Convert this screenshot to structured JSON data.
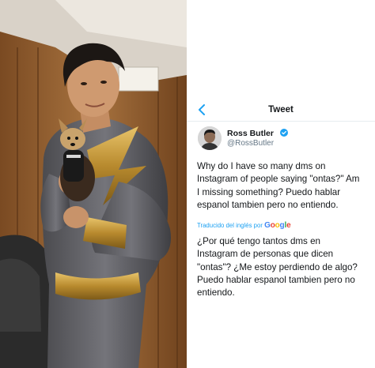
{
  "photo": {
    "description_icon": "person-photo"
  },
  "nav": {
    "back_icon": "chevron-left-icon",
    "title": "Tweet"
  },
  "author": {
    "display_name": "Ross Butler",
    "handle": "@RossButler",
    "verified": true
  },
  "tweet": {
    "text": "Why do I have so many dms on\nInstagram of people saying \"ontas?\" Am\nI missing something? Puedo hablar\nespanol tambien pero no entiendo.",
    "translation_label": "Traducido del inglés por",
    "translation_provider": "Google",
    "translated_text": "¿Por qué tengo tantos dms en\nInstagram de personas que dicen\n\"ontas\"? ¿Me estoy perdiendo de algo?\nPuedo hablar espanol tambien pero no\nentiendo."
  },
  "colors": {
    "accent": "#1da1f2",
    "text": "#14171a",
    "secondary_text": "#657786"
  }
}
